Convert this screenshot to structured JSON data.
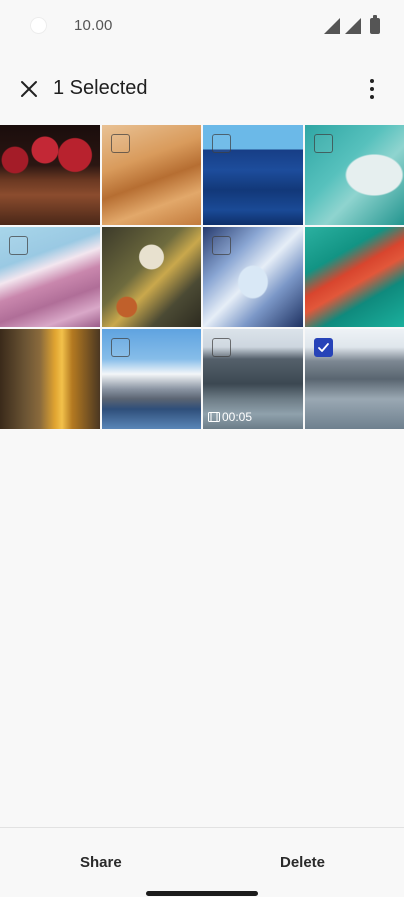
{
  "status_bar": {
    "time": "10.00"
  },
  "app_bar": {
    "title": "1 Selected"
  },
  "gallery": {
    "items": [
      {
        "kind": "photo",
        "subject": "pomegranates",
        "checkbox": false,
        "selected": false
      },
      {
        "kind": "photo",
        "subject": "sand dunes",
        "checkbox": true,
        "selected": false
      },
      {
        "kind": "photo",
        "subject": "blue architecture",
        "checkbox": true,
        "selected": false
      },
      {
        "kind": "photo",
        "subject": "coastline aerial",
        "checkbox": true,
        "selected": false
      },
      {
        "kind": "photo",
        "subject": "pink waves",
        "checkbox": true,
        "selected": false
      },
      {
        "kind": "photo",
        "subject": "food spread",
        "checkbox": false,
        "selected": false
      },
      {
        "kind": "photo",
        "subject": "building courtyard",
        "checkbox": true,
        "selected": false
      },
      {
        "kind": "photo",
        "subject": "red bridge",
        "checkbox": false,
        "selected": false
      },
      {
        "kind": "photo",
        "subject": "waterfall",
        "checkbox": false,
        "selected": false
      },
      {
        "kind": "photo",
        "subject": "mountain lake",
        "checkbox": true,
        "selected": false
      },
      {
        "kind": "video",
        "subject": "harbor buildings",
        "checkbox": true,
        "selected": false,
        "duration": "00:05"
      },
      {
        "kind": "photo",
        "subject": "harbor marina",
        "checkbox": true,
        "selected": true
      }
    ]
  },
  "bottom_bar": {
    "share_label": "Share",
    "delete_label": "Delete"
  },
  "colors": {
    "accent": "#2743b8",
    "background": "#f8f8f8"
  }
}
